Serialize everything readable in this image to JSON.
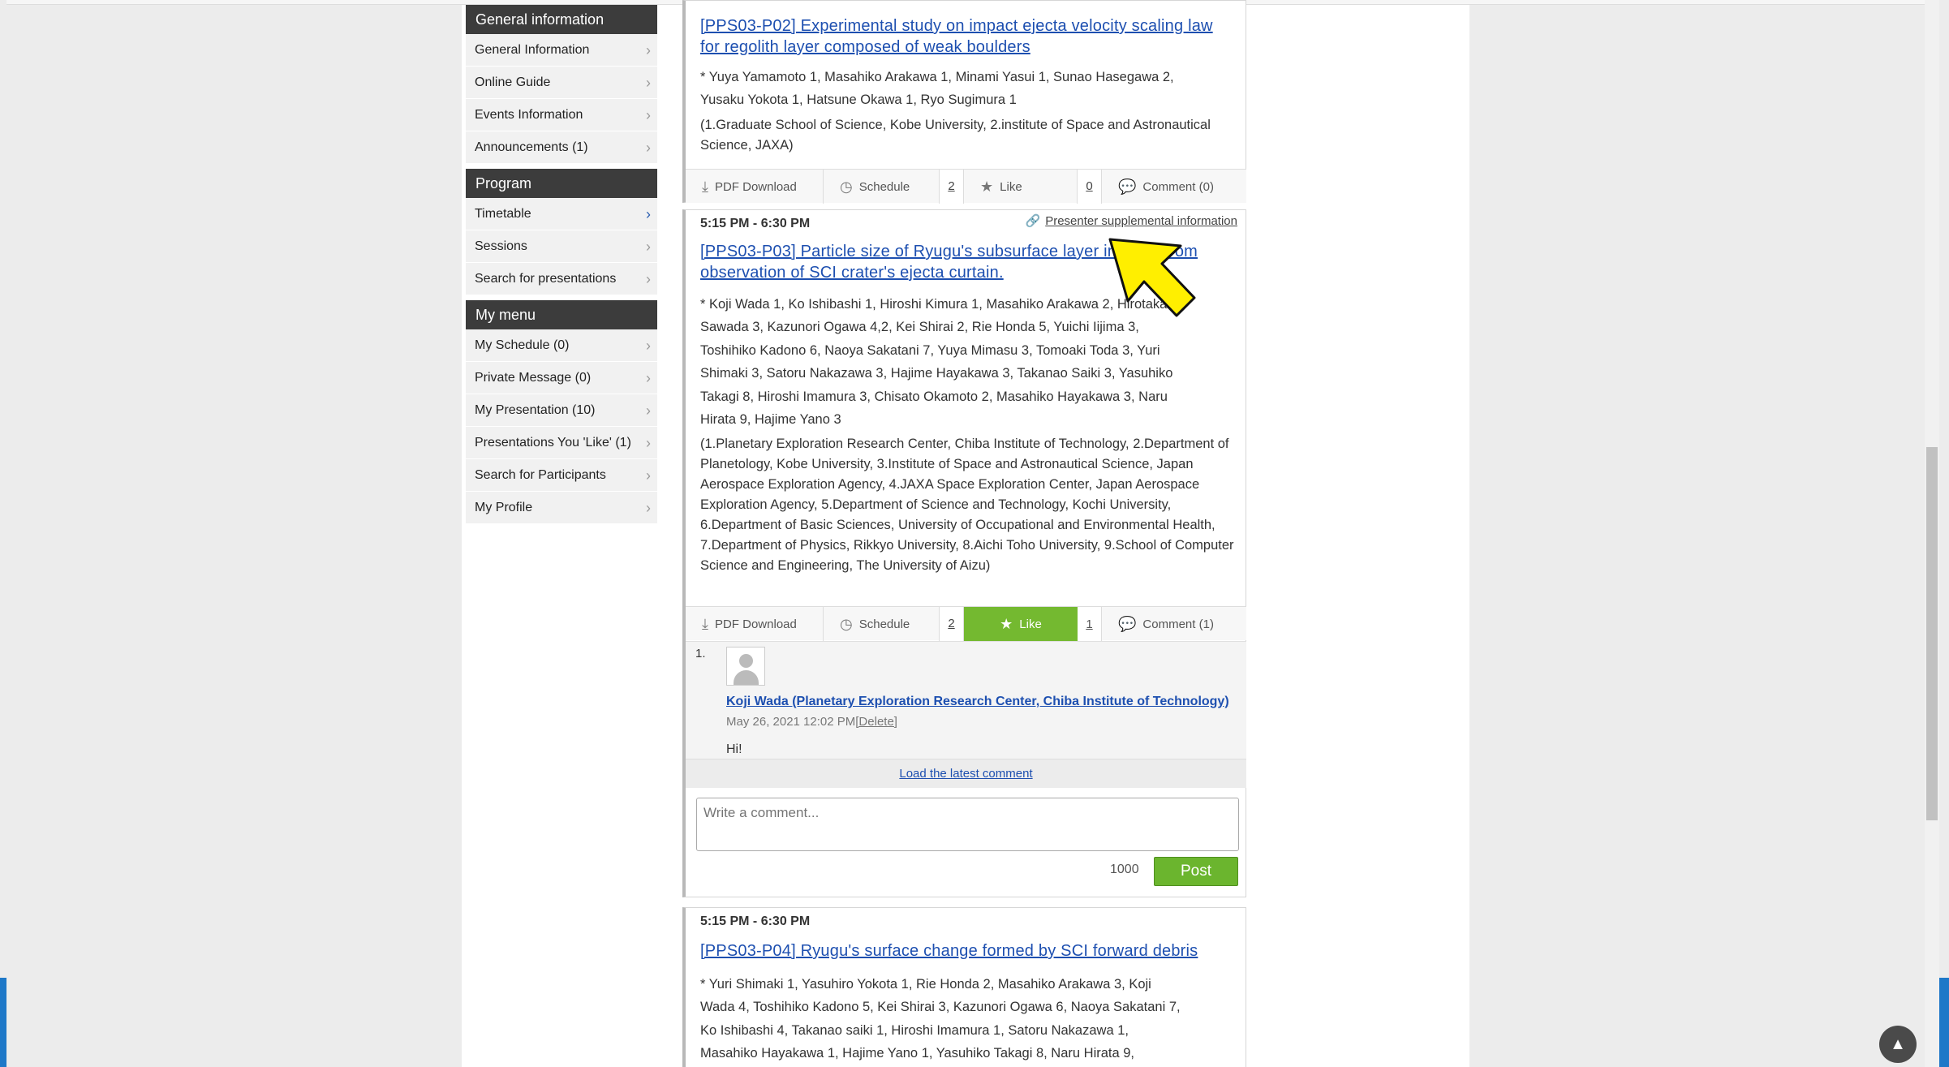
{
  "sidebar": {
    "sections": [
      {
        "title": "General information",
        "items": [
          "General Information",
          "Online Guide",
          "Events Information",
          "Announcements (1)"
        ]
      },
      {
        "title": "Program",
        "items": [
          "Timetable",
          "Sessions",
          "Search for presentations"
        ]
      },
      {
        "title": "My menu",
        "items": [
          "My Schedule (0)",
          "Private Message (0)",
          "My Presentation (10)",
          "Presentations You 'Like' (1)",
          "Search for Participants",
          "My Profile"
        ]
      }
    ]
  },
  "cards": [
    {
      "title": "[PPS03-P02] Experimental study on impact ejecta velocity scaling law for regolith layer composed of weak boulders",
      "authors_line1": "* Yuya Yamamoto 1,  Masahiko Arakawa 1,  Minami Yasui 1,  Sunao Hasegawa 2,",
      "authors_line2": "Yusaku Yokota 1,  Hatsune Okawa 1,  Ryo Sugimura 1",
      "affiliation": "(1.Graduate School of Science, Kobe University, 2.institute of Space and Astronautical Science, JAXA)",
      "actions": {
        "pdf": "PDF Download",
        "schedule": "Schedule",
        "schedule_count": "2",
        "like": "Like",
        "like_count": "0",
        "comment": "Comment (0)"
      }
    },
    {
      "time": "5:15 PM - 6:30 PM",
      "supplemental": "Presenter supplemental information",
      "title": "[PPS03-P03] Particle size of Ryugu's subsurface layer inferred from observation of SCI crater's ejecta curtain.",
      "authors": [
        "* Koji Wada 1,  Ko Ishibashi 1,  Hiroshi Kimura 1,  Masahiko Arakawa 2,  Hirotaka",
        "Sawada 3,  Kazunori Ogawa 4,2,  Kei Shirai 2,  Rie Honda 5,  Yuichi Iijima 3,",
        "Toshihiko Kadono 6,  Naoya Sakatani 7,  Yuya Mimasu 3,  Tomoaki Toda 3,  Yuri",
        "Shimaki 3,  Satoru Nakazawa 3,  Hajime Hayakawa 3,  Takanao Saiki 3,  Yasuhiko",
        "Takagi 8,  Hiroshi Imamura 3,  Chisato Okamoto 2,  Masahiko Hayakawa 3,  Naru",
        "Hirata 9,  Hajime Yano 3"
      ],
      "affiliation": "(1.Planetary Exploration Research Center, Chiba Institute of Technology, 2.Department of Planetology, Kobe University, 3.Institute of Space and Astronautical Science, Japan Aerospace Exploration Agency, 4.JAXA Space Exploration Center, Japan Aerospace Exploration Agency, 5.Department of Science and Technology, Kochi University, 6.Department of Basic Sciences, University of Occupational and Environmental Health, 7.Department of Physics, Rikkyo University, 8.Aichi Toho University, 9.School of Computer Science and Engineering, The University of Aizu)",
      "actions": {
        "pdf": "PDF Download",
        "schedule": "Schedule",
        "schedule_count": "2",
        "like": "Like",
        "like_count": "1",
        "comment": "Comment (1)"
      },
      "comment": {
        "index": "1.",
        "author": "Koji Wada (Planetary Exploration Research Center, Chiba Institute of Technology)",
        "date": "May 26, 2021 12:02 PM",
        "delete": "[Delete]",
        "text": "Hi!"
      },
      "load_latest": "Load the latest comment",
      "comment_placeholder": "Write a comment...",
      "char_counter": "1000",
      "post": "Post"
    },
    {
      "time": "5:15 PM - 6:30 PM",
      "title": "[PPS03-P04] Ryugu's surface change formed by SCI forward debris",
      "authors": [
        "* Yuri Shimaki 1,  Yasuhiro Yokota 1,  Rie Honda 2,  Masahiko Arakawa 3,  Koji",
        "Wada 4,  Toshihiko Kadono 5,  Kei Shirai 3,  Kazunori Ogawa 6,  Naoya Sakatani 7,",
        "Ko Ishibashi 4,  Takanao saiki 1,  Hiroshi Imamura 1,  Satoru Nakazawa 1,",
        "Masahiko Hayakawa 1,  Hajime Yano 1,  Yasuhiko Takagi 8,  Naru Hirata 9,"
      ]
    }
  ],
  "colors": {
    "accent_green": "#74b930",
    "link_blue": "#1d4fb0",
    "header_dark": "#3c3c3c"
  }
}
